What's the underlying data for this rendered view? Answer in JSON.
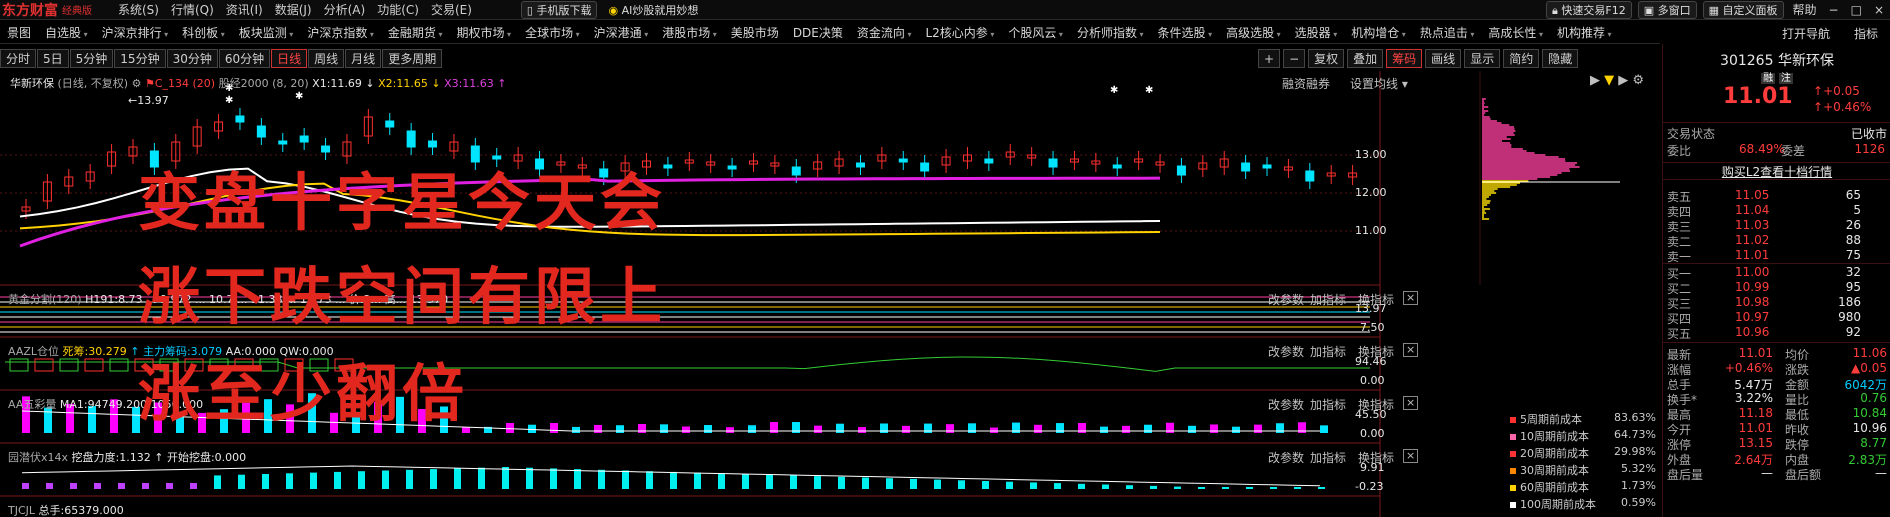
{
  "app": {
    "brand": "东方财富",
    "edition": "经典版",
    "menu": [
      "系统(S)",
      "行情(Q)",
      "资讯(I)",
      "数据(J)",
      "分析(A)",
      "功能(C)",
      "交易(E)"
    ],
    "download": "手机版下载",
    "ai_promo": "AI炒股就用妙想",
    "quick_trade": "快速交易F12",
    "multi_window": "多窗口",
    "custom_panel": "自定义面板",
    "window_controls": [
      "帮助",
      "−",
      "□",
      "×"
    ]
  },
  "nav": {
    "items": [
      "景图",
      "自选股",
      "沪深京排行",
      "科创板",
      "板块监测",
      "沪深京指数",
      "金融期货",
      "期权市场",
      "全球市场",
      "沪深港通",
      "港股市场",
      "美股市场",
      "DDE决策",
      "资金流向",
      "L2核心内参",
      "个股风云",
      "分析师指数",
      "条件选股",
      "高级选股",
      "选股器",
      "机构增仓",
      "热点追击",
      "高成长性",
      "机构推荐"
    ],
    "right": [
      "打开导航",
      "指标"
    ]
  },
  "toolbar": {
    "periods": [
      "分时",
      "5日",
      "5分钟",
      "15分钟",
      "30分钟",
      "60分钟",
      "日线",
      "周线",
      "月线",
      "更多周期"
    ],
    "active": "日线",
    "right": [
      "+",
      "−",
      "复权",
      "叠加",
      "筹码",
      "画线",
      "显示",
      "简约",
      "隐藏"
    ]
  },
  "chart": {
    "stock_name": "华新环保",
    "mode": "(日线, 不复权)",
    "indicator": "C_134 (20)",
    "ma_label": "股经2000 (8, 20)",
    "x1": "X1:11.69",
    "x2": "X2:11.65",
    "x3": "X3:11.63",
    "margin": "融资融券",
    "setmy": "设置均线",
    "high_marker": "13.97",
    "price_axis": [
      "13.00",
      "12.00",
      "11.00"
    ]
  },
  "panels": {
    "p1": {
      "label": "黄金分割(120)",
      "vals": "H191:8.73   ... 9.972 ... 10.7 ... 11.38 ... 12.73 ... 价:2... 高... 13.970",
      "axis": [
        "13.97",
        "7.50"
      ]
    },
    "p2": {
      "label": "AAZL仓位",
      "v1": "死筹:30.279",
      "v2": "主力筹码:3.079",
      "v3": "AA:0.000",
      "v4": "QW:0.000",
      "axis": [
        "94.46",
        "0.00"
      ]
    },
    "p3": {
      "label": "AA五彩量",
      "v1": "MA1:94749.200",
      "v2": "1050.000",
      "axis": [
        "45.50",
        "0.00"
      ]
    },
    "p4": {
      "label": "园潜伏x14x",
      "v1": "挖盘力度:1.132",
      "v2": "开始挖盘:0.000",
      "axis": [
        "9.91",
        "-0.23"
      ]
    },
    "p5": {
      "label": "TJCJL",
      "v1": "总手:65379.000"
    },
    "controls": [
      "改参数",
      "加指标",
      "换指标",
      "×"
    ]
  },
  "overlay": {
    "line1": "变盘十字星今天会",
    "line2": "涨下跌空间有限上",
    "line3": "涨至少翻倍"
  },
  "cost_legend": [
    {
      "label": "5周期前成本",
      "value": "83.63%",
      "color": "#ff3030"
    },
    {
      "label": "10周期前成本",
      "value": "64.73%",
      "color": "#ff66aa"
    },
    {
      "label": "20周期前成本",
      "value": "29.98%",
      "color": "#ff3333"
    },
    {
      "label": "30周期前成本",
      "value": "5.32%",
      "color": "#ff8800"
    },
    {
      "label": "60周期前成本",
      "value": "1.73%",
      "color": "#ffd200"
    },
    {
      "label": "100周期前成本",
      "value": "0.59%",
      "color": "#ffffff"
    }
  ],
  "quote": {
    "code": "301265",
    "name": "华新环保",
    "tags": [
      "融",
      "注"
    ],
    "price": "11.01",
    "change": "+0.05",
    "pct": "+0.46%",
    "status_label": "交易状态",
    "status": "已收市",
    "weibi_label": "委比",
    "weibi": "68.49%",
    "weicha_label": "委差",
    "weicha": "1126",
    "l2_link": "购买L2查看十档行情",
    "asks": [
      {
        "l": "卖五",
        "p": "11.05",
        "v": "65"
      },
      {
        "l": "卖四",
        "p": "11.04",
        "v": "5"
      },
      {
        "l": "卖三",
        "p": "11.03",
        "v": "26"
      },
      {
        "l": "卖二",
        "p": "11.02",
        "v": "88"
      },
      {
        "l": "卖一",
        "p": "11.01",
        "v": "75"
      }
    ],
    "bids": [
      {
        "l": "买一",
        "p": "11.00",
        "v": "32"
      },
      {
        "l": "买二",
        "p": "10.99",
        "v": "95"
      },
      {
        "l": "买三",
        "p": "10.98",
        "v": "186"
      },
      {
        "l": "买四",
        "p": "10.97",
        "v": "980"
      },
      {
        "l": "买五",
        "p": "10.96",
        "v": "92"
      }
    ],
    "stats": [
      [
        "最新",
        "11.01",
        "r",
        "均价",
        "11.06",
        "r"
      ],
      [
        "涨幅",
        "+0.46%",
        "r",
        "涨跌",
        "▲0.05",
        "r"
      ],
      [
        "总手",
        "5.47万",
        "w",
        "金额",
        "6042万",
        "c"
      ],
      [
        "换手*",
        "3.22%",
        "w",
        "量比",
        "0.76",
        "g"
      ],
      [
        "最高",
        "11.18",
        "r",
        "最低",
        "10.84",
        "g"
      ],
      [
        "今开",
        "11.01",
        "r",
        "昨收",
        "10.96",
        "w"
      ],
      [
        "涨停",
        "13.15",
        "r",
        "跌停",
        "8.77",
        "g"
      ],
      [
        "外盘",
        "2.64万",
        "r",
        "内盘",
        "2.83万",
        "g"
      ],
      [
        "盘后量",
        "—",
        "w",
        "盘后额",
        "—",
        "w"
      ]
    ]
  }
}
